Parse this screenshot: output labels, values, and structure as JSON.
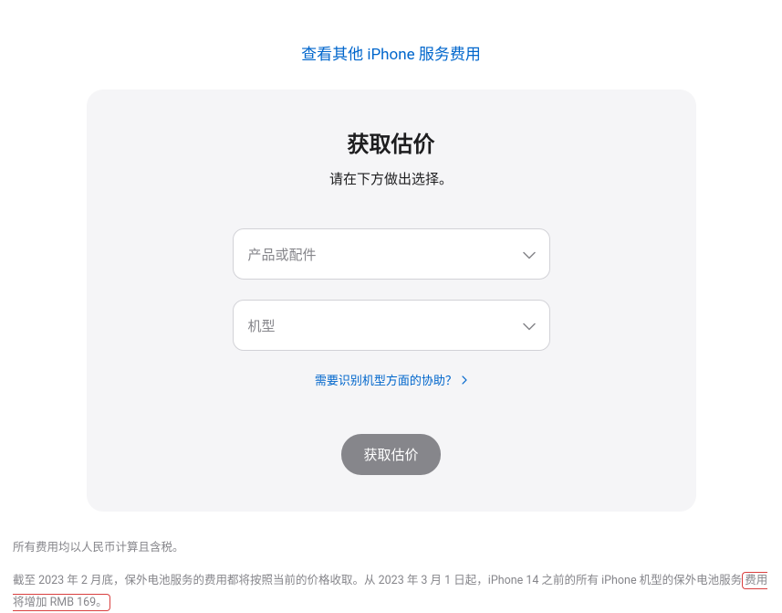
{
  "topLink": {
    "text": "查看其他 iPhone 服务费用"
  },
  "card": {
    "title": "获取估价",
    "subtitle": "请在下方做出选择。",
    "selects": {
      "product": {
        "placeholder": "产品或配件"
      },
      "model": {
        "placeholder": "机型"
      }
    },
    "helpLink": {
      "text": "需要识别机型方面的协助？"
    },
    "button": {
      "label": "获取估价"
    }
  },
  "footer": {
    "line1": "所有费用均以人民币计算且含税。",
    "line2_prefix": "截至 2023 年 2 月底，保外电池服务的费用都将按照当前的价格收取。从 2023 年 3 月 1 日起，iPhone 14 之前的所有 iPhone 机型的保外电池服务",
    "line2_highlight": "费用将增加 RMB 169。"
  }
}
